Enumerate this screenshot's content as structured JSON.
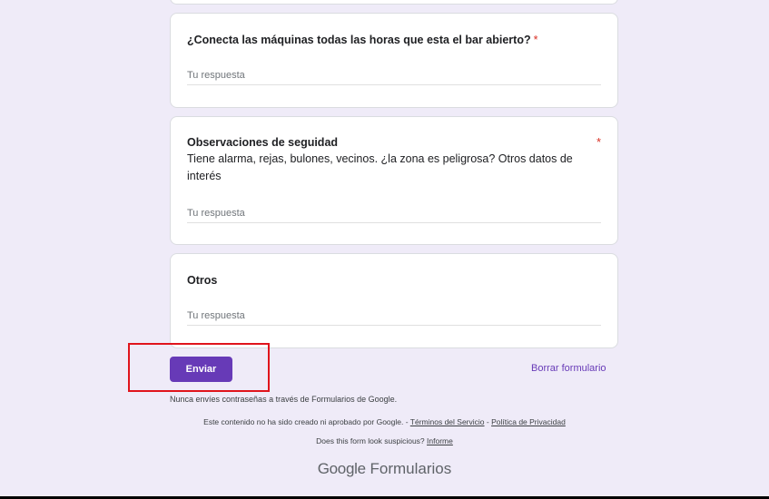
{
  "questions": [
    {
      "title": "¿Conecta las máquinas todas las horas que esta el bar abierto?",
      "required_mark": "*",
      "placeholder": "Tu respuesta"
    },
    {
      "title": "Observaciones de seguidad",
      "required_mark": "*",
      "description": "Tiene alarma, rejas, bulones, vecinos. ¿la zona es peligrosa? Otros datos de interés",
      "placeholder": "Tu respuesta"
    },
    {
      "title": "Otros",
      "placeholder": "Tu respuesta"
    }
  ],
  "actions": {
    "submit_label": "Enviar",
    "clear_label": "Borrar formulario"
  },
  "footer": {
    "warning": "Nunca envíes contraseñas a través de Formularios de Google.",
    "disclaimer_prefix": "Este contenido no ha sido creado ni aprobado por Google. - ",
    "terms_link": "Términos del Servicio",
    "separator": " - ",
    "privacy_link": "Política de Privacidad",
    "suspicious_prefix": "Does this form look suspicious? ",
    "report_link": "Informe",
    "brand_google": "Google",
    "brand_product": "Formularios"
  },
  "colors": {
    "accent": "#673ab7",
    "background": "#efebf8",
    "required": "#d93025",
    "highlight": "#e0141c"
  }
}
